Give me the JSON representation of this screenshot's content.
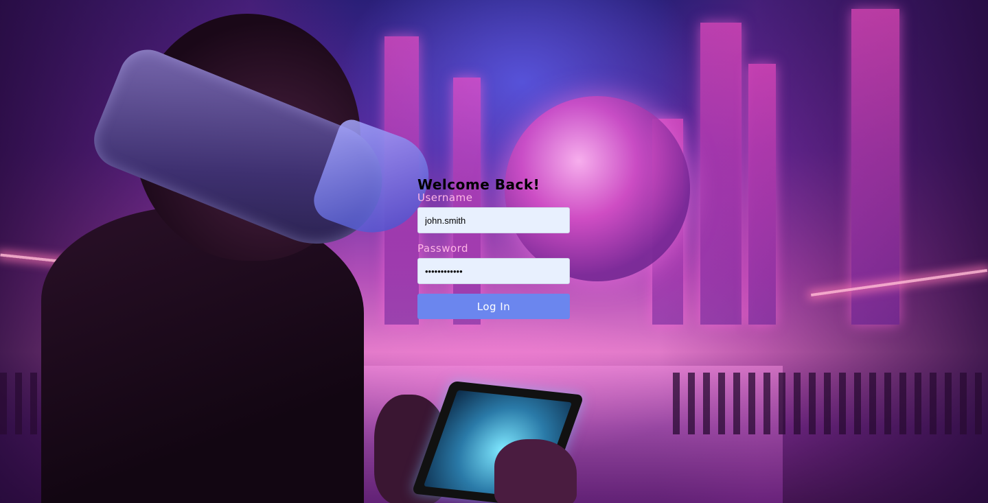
{
  "login": {
    "title": "Welcome Back!",
    "username_label": "Username",
    "username_value": "john.smith",
    "password_label": "Password",
    "password_value": "••••••••••••",
    "submit_label": "Log In"
  },
  "colors": {
    "button": "#6b86ee",
    "field_bg": "#e8f0fe",
    "label": "#ffb6e6",
    "title": "#000000"
  },
  "background": {
    "icon": "cyberpunk-city-vr-illustration"
  }
}
